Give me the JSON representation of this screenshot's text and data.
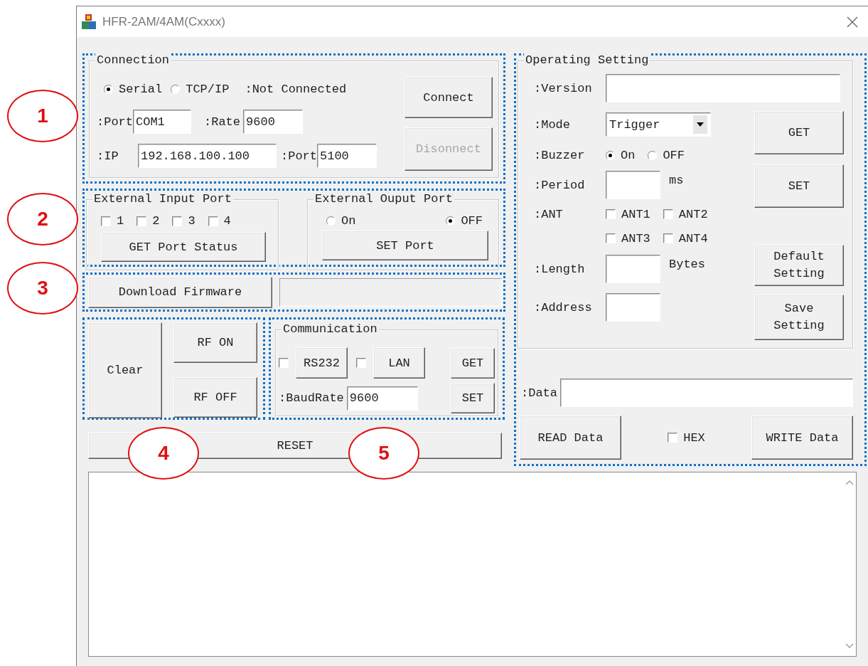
{
  "window": {
    "title": "HFR-2AM/4AM(Cxxxx)"
  },
  "annotations": [
    {
      "label": "1"
    },
    {
      "label": "2"
    },
    {
      "label": "3"
    },
    {
      "label": "4"
    },
    {
      "label": "5"
    }
  ],
  "connection": {
    "title": "Connection",
    "modes": [
      {
        "label": "Serial",
        "selected": true
      },
      {
        "label": "TCP/IP",
        "selected": false
      }
    ],
    "status": ":Not Connected",
    "port_label": ":Port",
    "port": "COM1",
    "rate_label": ":Rate",
    "rate": "9600",
    "ip_label": ":IP",
    "ip": "192.168.100.100",
    "ip_port_label": ":Port",
    "ip_port": "5100",
    "buttons": [
      {
        "label": "Connect",
        "disabled": false
      },
      {
        "label": "Disonnect",
        "disabled": true
      }
    ]
  },
  "external_input": {
    "title": "External Input Port",
    "ports": [
      {
        "label": "1",
        "checked": false
      },
      {
        "label": "2",
        "checked": false
      },
      {
        "label": "3",
        "checked": false
      },
      {
        "label": "4",
        "checked": false
      }
    ],
    "button": "GET Port Status"
  },
  "external_output": {
    "title": "External Ouput Port",
    "options": [
      {
        "label": "On",
        "selected": false
      },
      {
        "label": "OFF",
        "selected": true
      }
    ],
    "button": "SET Port"
  },
  "firmware": {
    "button": "Download Firmware"
  },
  "rf": {
    "clear": "Clear",
    "on": "RF ON",
    "off": "RF OFF"
  },
  "communication": {
    "title": "Communication",
    "interfaces": [
      {
        "label": "RS232",
        "checked": false
      },
      {
        "label": "LAN",
        "checked": false
      }
    ],
    "baud_label": ":BaudRate",
    "baud": "9600",
    "buttons": [
      "GET",
      "SET"
    ]
  },
  "reset": "RESET",
  "operating": {
    "title": "Operating Setting",
    "version_label": ":Version",
    "mode_label": ":Mode",
    "mode": "Trigger",
    "buzzer_label": ":Buzzer",
    "buzzer": [
      {
        "label": "On",
        "selected": true
      },
      {
        "label": "OFF",
        "selected": false
      }
    ],
    "period_label": ":Period",
    "period_unit": "ms",
    "ant_label": ":ANT",
    "ants": [
      {
        "label": "ANT1",
        "checked": false
      },
      {
        "label": "ANT2",
        "checked": false
      },
      {
        "label": "ANT3",
        "checked": false
      },
      {
        "label": "ANT4",
        "checked": false
      }
    ],
    "length_label": ":Length",
    "length_unit": "Bytes",
    "address_label": ":Address",
    "buttons": [
      "GET",
      "SET",
      "Default Setting",
      "Save Setting"
    ]
  },
  "data": {
    "label": ":Data",
    "read": "READ Data",
    "hex": {
      "label": "HEX",
      "checked": false
    },
    "write": "WRITE Data"
  }
}
